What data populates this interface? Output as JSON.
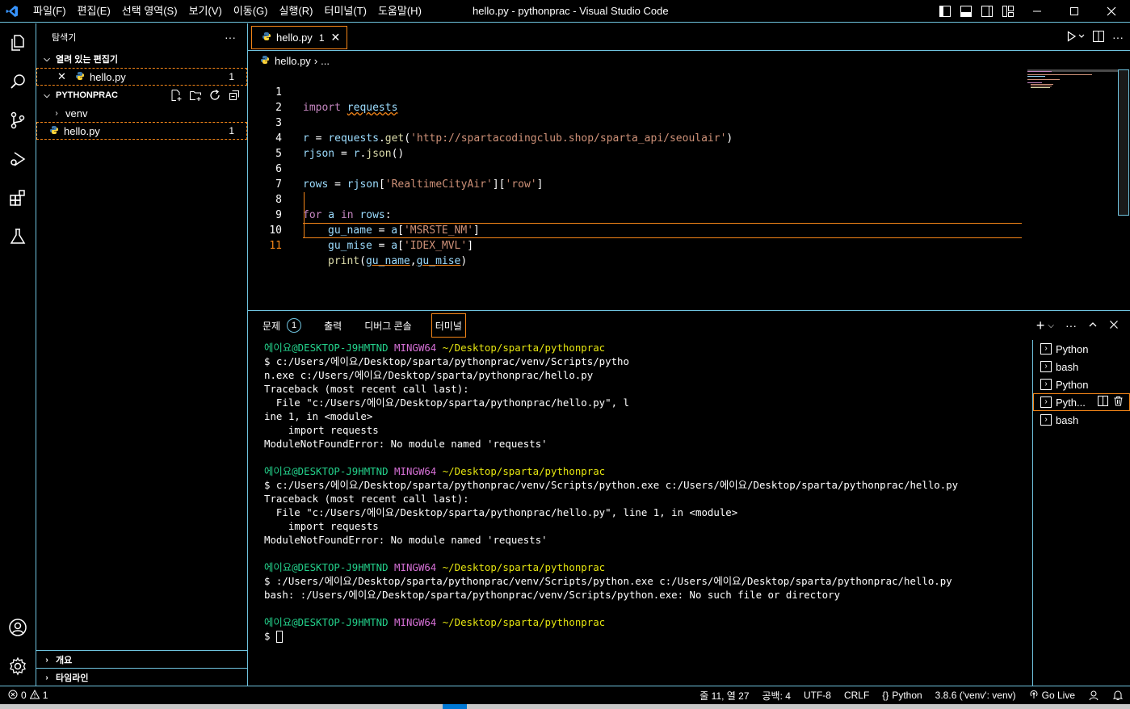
{
  "window": {
    "title": "hello.py - pythonprac - Visual Studio Code",
    "menus": [
      "파일(F)",
      "편집(E)",
      "선택 영역(S)",
      "보기(V)",
      "이동(G)",
      "실행(R)",
      "터미널(T)",
      "도움말(H)"
    ]
  },
  "sidebar": {
    "title": "탐색기",
    "open_editors_label": "열려 있는 편집기",
    "open_editor_file": "hello.py",
    "open_editor_badge": "1",
    "project_label": "PYTHONPRAC",
    "tree": [
      {
        "label": "venv",
        "type": "folder"
      },
      {
        "label": "hello.py",
        "type": "file",
        "badge": "1"
      }
    ],
    "outline_label": "개요",
    "timeline_label": "타임라인"
  },
  "editor": {
    "tab_label": "hello.py",
    "tab_badge": "1",
    "breadcrumb_file": "hello.py",
    "breadcrumb_rest": "...",
    "line_numbers": [
      "1",
      "2",
      "3",
      "4",
      "5",
      "6",
      "7",
      "8",
      "9",
      "10",
      "11"
    ],
    "lines": {
      "l1_kw": "import",
      "l1_mod": "requests",
      "l3_a": "r",
      "l3_b": " = ",
      "l3_c": "requests",
      "l3_d": ".",
      "l3_e": "get",
      "l3_f": "(",
      "l3_g": "'http://spartacodingclub.shop/sparta_api/seoulair'",
      "l3_h": ")",
      "l4_a": "rjson",
      "l4_b": " = ",
      "l4_c": "r",
      "l4_d": ".",
      "l4_e": "json",
      "l4_f": "()",
      "l6_a": "rows",
      "l6_b": " = ",
      "l6_c": "rjson",
      "l6_d": "[",
      "l6_e": "'RealtimeCityAir'",
      "l6_f": "][",
      "l6_g": "'row'",
      "l6_h": "]",
      "l8_a": "for",
      "l8_b": " a ",
      "l8_c": "in",
      "l8_d": " rows",
      "l8_e": ":",
      "l9_a": "gu_name",
      "l9_b": " = ",
      "l9_c": "a",
      "l9_d": "[",
      "l9_e": "'MSRSTE_NM'",
      "l9_f": "]",
      "l10_a": "gu_mise",
      "l10_b": " = ",
      "l10_c": "a",
      "l10_d": "[",
      "l10_e": "'IDEX_MVL'",
      "l10_f": "]",
      "l11_a": "print",
      "l11_b": "(",
      "l11_c": "gu_name",
      "l11_d": ",",
      "l11_e": "gu_mise",
      "l11_f": ")"
    }
  },
  "panel": {
    "tabs": [
      {
        "label": "문제",
        "badge": "1"
      },
      {
        "label": "출력"
      },
      {
        "label": "디버그 콘솔"
      },
      {
        "label": "터미널"
      }
    ],
    "terminal": {
      "prompt_user": "에이요@DESKTOP-J9HMTND",
      "prompt_env": "MINGW64",
      "prompt_path": "~/Desktop/sparta/pythonprac",
      "lines_block1": [
        "$ c:/Users/에이요/Desktop/sparta/pythonprac/venv/Scripts/pytho",
        "n.exe c:/Users/에이요/Desktop/sparta/pythonprac/hello.py",
        "Traceback (most recent call last):",
        "  File \"c:/Users/에이요/Desktop/sparta/pythonprac/hello.py\", l",
        "ine 1, in <module>",
        "    import requests",
        "ModuleNotFoundError: No module named 'requests'"
      ],
      "lines_block2": [
        "$ c:/Users/에이요/Desktop/sparta/pythonprac/venv/Scripts/python.exe c:/Users/에이요/Desktop/sparta/pythonprac/hello.py",
        "Traceback (most recent call last):",
        "  File \"c:/Users/에이요/Desktop/sparta/pythonprac/hello.py\", line 1, in <module>",
        "    import requests",
        "ModuleNotFoundError: No module named 'requests'"
      ],
      "lines_block3": [
        "$ :/Users/에이요/Desktop/sparta/pythonprac/venv/Scripts/python.exe c:/Users/에이요/Desktop/sparta/pythonprac/hello.py",
        "bash: :/Users/에이요/Desktop/sparta/pythonprac/venv/Scripts/python.exe: No such file or directory"
      ],
      "final_prompt": "$ "
    },
    "terminal_list": [
      {
        "label": "Python"
      },
      {
        "label": "bash"
      },
      {
        "label": "Python"
      },
      {
        "label": "Pyth..."
      },
      {
        "label": "bash"
      }
    ]
  },
  "statusbar": {
    "errors": "0",
    "warnings": "1",
    "position": "줄 11, 열 27",
    "spaces": "공백: 4",
    "encoding": "UTF-8",
    "eol": "CRLF",
    "language": "Python",
    "interpreter": "3.8.6 ('venv': venv)",
    "golive": "Go Live"
  },
  "colors": {
    "contrast_border": "#6fc3df",
    "active_border": "#f38518",
    "keyword": "#c586c0",
    "string": "#ce9178",
    "function": "#dcdcaa",
    "variable": "#9cdcfe",
    "terminal_user": "#23d18b",
    "terminal_env": "#d670d6",
    "terminal_path": "#e5e510"
  }
}
